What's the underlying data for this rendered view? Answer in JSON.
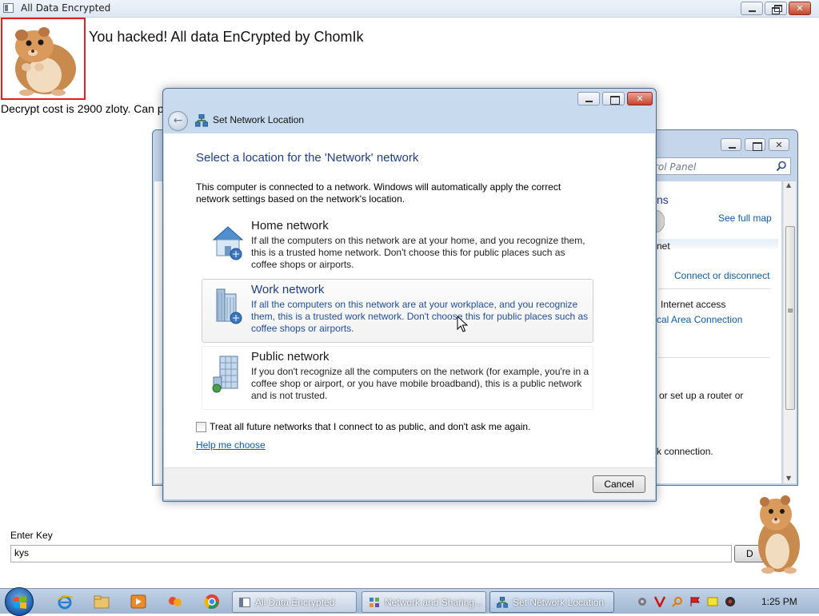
{
  "app": {
    "title": "All Data Encrypted",
    "headline": "You hacked! All data EnCrypted by ChomIk",
    "cost_text": "Decrypt cost is 2900 zloty. Can pa",
    "key_label": "Enter Key",
    "key_value": "kys",
    "decrypt_button_label": "D"
  },
  "control_panel": {
    "search_placeholder": "rol Panel",
    "fragment_heading": "ns",
    "see_full_map": "See full map",
    "internet_fragment": "net",
    "connect_or_disconnect": "Connect or disconnect",
    "access_type": "Internet access",
    "local_area_connection": "cal Area Connection",
    "router_fragment": "or set up a router or",
    "connection_fragment": "k connection."
  },
  "dialog": {
    "title": "Set Network Location",
    "heading": "Select a location for the 'Network' network",
    "intro": "This computer is connected to a network. Windows will automatically apply the correct network settings based on the network's location.",
    "options": [
      {
        "title": "Home network",
        "description": "If all the computers on this network are at your home, and you recognize them, this is a trusted home network.  Don't choose this for public places such as coffee shops or airports."
      },
      {
        "title": "Work network",
        "description": "If all the computers on this network are at your workplace, and you recognize them, this is a trusted work network.  Don't choose this for public places such as coffee shops or airports."
      },
      {
        "title": "Public network",
        "description": "If you don't recognize all the computers on the network (for example, you're in a coffee shop or airport, or you have mobile broadband), this is a public network and is not trusted."
      }
    ],
    "checkbox_label": "Treat all future networks that I connect to as public, and don't ask me again.",
    "help_link": "Help me choose",
    "cancel_label": "Cancel"
  },
  "taskbar": {
    "buttons": [
      {
        "label": "All Data Encrypted"
      },
      {
        "label": "Network and Sharing..."
      },
      {
        "label": "Set Network Location"
      }
    ],
    "clock": "1:25 PM"
  },
  "colors": {
    "accent_blue": "#1e3f87",
    "link_blue": "#0d5ca6",
    "alert_red": "#e02020"
  }
}
